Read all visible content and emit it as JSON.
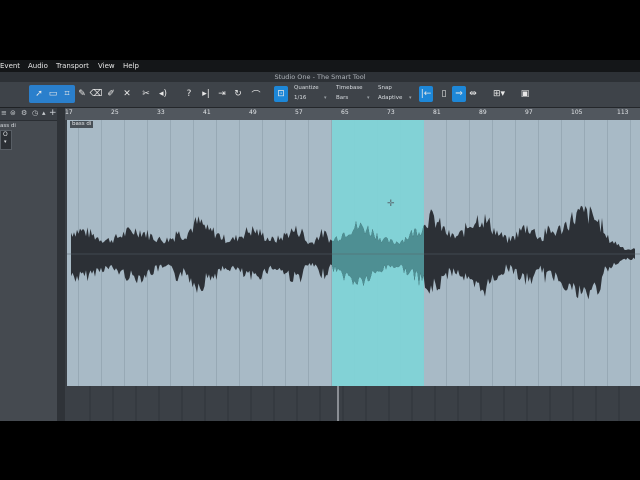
{
  "menu": [
    "Event",
    "Audio",
    "Transport",
    "View",
    "Help"
  ],
  "app_title": "Studio One - The Smart Tool",
  "toolbar": {
    "quantize": {
      "label": "Quantize",
      "value": "1/16"
    },
    "timebase": {
      "label": "Timebase",
      "value": "Bars"
    },
    "snap": {
      "label": "Snap",
      "value": "Adaptive"
    },
    "tools": [
      "arrow-tool-icon",
      "range-tool-icon",
      "pencil-tool-icon",
      "eraser-tool-icon",
      "paint-tool-icon",
      "mute-tool-icon",
      "split-tool-icon",
      "listen-tool-icon"
    ],
    "colors": {
      "active": "#1d87d8"
    }
  },
  "inspector": {
    "track_name": "ass di",
    "box_letter": "O"
  },
  "ruler": {
    "bars": [
      "17",
      "25",
      "33",
      "41",
      "49",
      "57",
      "65",
      "73",
      "81",
      "89",
      "97",
      "105",
      "113"
    ]
  },
  "event": {
    "name": "bass di",
    "colors": {
      "body": "#a8bac6",
      "waveform": "#2c3036",
      "selection": "#7fd3d7"
    },
    "selection_range_bars": [
      65,
      81
    ]
  }
}
